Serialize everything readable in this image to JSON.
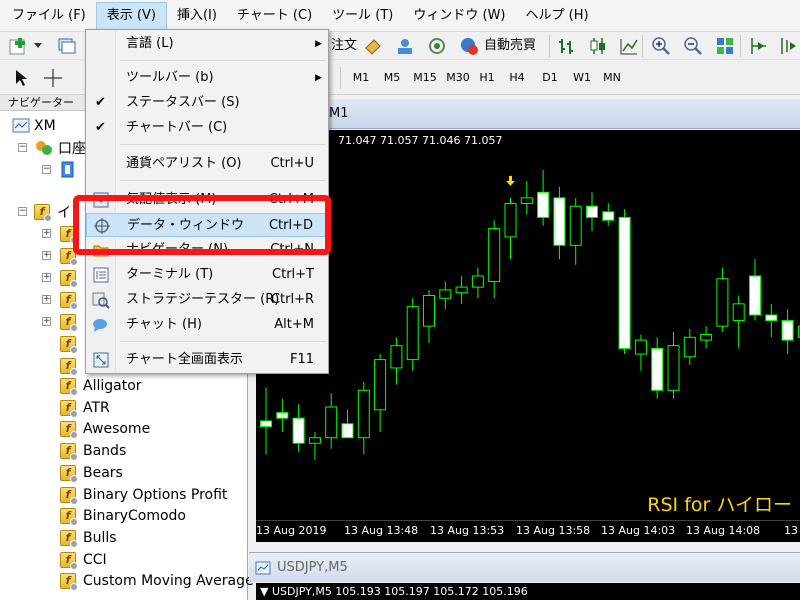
{
  "menubar": [
    "ファイル (F)",
    "表示 (V)",
    "挿入(I)",
    "チャート (C)",
    "ツール (T)",
    "ウィンドウ (W)",
    "ヘルプ (H)"
  ],
  "toolbar": {
    "order_label": "注文",
    "auto_trade_label": "自動売買"
  },
  "timeframes": [
    "M1",
    "M5",
    "M15",
    "M30",
    "H1",
    "H4",
    "D1",
    "W1",
    "MN"
  ],
  "navigator": {
    "title": "ナビゲーター",
    "root": "XM",
    "accounts_label": "口座",
    "indicators_label": "イ",
    "indicators": [
      "Alligator",
      "ATR",
      "Awesome",
      "Bands",
      "Bears",
      "Binary Options Profit",
      "BinaryComodo",
      "Bulls",
      "CCI",
      "Custom Moving Average"
    ]
  },
  "view_menu": {
    "items": [
      {
        "label": "言語 (L)",
        "shortcut": "",
        "submenu": true
      },
      {
        "label": "ツールバー (b)",
        "shortcut": "",
        "submenu": true
      },
      {
        "label": "ステータスバー (S)",
        "shortcut": "",
        "checked": true
      },
      {
        "label": "チャートバー (C)",
        "shortcut": "",
        "checked": true
      },
      {
        "label": "通貨ペアリスト (O)",
        "shortcut": "Ctrl+U"
      },
      {
        "label": "気配値表示 (M)",
        "shortcut": "Ctrl+M"
      },
      {
        "label": "データ・ウィンドウ",
        "shortcut": "Ctrl+D",
        "highlighted": true
      },
      {
        "label": "ナビゲーター (N)",
        "shortcut": "Ctrl+N"
      },
      {
        "label": "ターミナル (T)",
        "shortcut": "Ctrl+T"
      },
      {
        "label": "ストラテジーテスター (R)",
        "shortcut": "Ctrl+R"
      },
      {
        "label": "チャット (H)",
        "shortcut": "Alt+M"
      },
      {
        "label": "チャート全画面表示",
        "shortcut": "F11"
      }
    ]
  },
  "chart": {
    "title": "M1",
    "ohlc": "71.047 71.057 71.046 71.057",
    "watermark": "RSI for ハイロー",
    "x_ticks": [
      "13 Aug 2019",
      "13 Aug 13:48",
      "13 Aug 13:53",
      "13 Aug 13:58",
      "13 Aug 14:03",
      "13 Aug 14:08",
      "13"
    ],
    "colors": {
      "background": "#000000",
      "candle_outline": "#00ff00",
      "bull_body": "#000000",
      "bear_body": "#ffffff",
      "arrow": "#ffd700"
    }
  },
  "chart_data": {
    "type": "candlestick",
    "note_values_in_price_units": true,
    "candles": [
      {
        "o": 71.01,
        "h": 71.022,
        "l": 70.998,
        "c": 71.008
      },
      {
        "o": 71.013,
        "h": 71.018,
        "l": 71.006,
        "c": 71.011
      },
      {
        "o": 71.011,
        "h": 71.016,
        "l": 70.999,
        "c": 71.002
      },
      {
        "o": 71.002,
        "h": 71.006,
        "l": 70.996,
        "c": 71.004
      },
      {
        "o": 71.004,
        "h": 71.02,
        "l": 71.0,
        "c": 71.015
      },
      {
        "o": 71.009,
        "h": 71.014,
        "l": 71.004,
        "c": 71.004
      },
      {
        "o": 71.004,
        "h": 71.024,
        "l": 70.998,
        "c": 71.021
      },
      {
        "o": 71.014,
        "h": 71.034,
        "l": 71.006,
        "c": 71.032
      },
      {
        "o": 71.029,
        "h": 71.04,
        "l": 71.023,
        "c": 71.037
      },
      {
        "o": 71.032,
        "h": 71.054,
        "l": 71.028,
        "c": 71.051
      },
      {
        "o": 71.044,
        "h": 71.057,
        "l": 71.038,
        "c": 71.055
      },
      {
        "o": 71.054,
        "h": 71.06,
        "l": 71.05,
        "c": 71.057
      },
      {
        "o": 71.056,
        "h": 71.062,
        "l": 71.052,
        "c": 71.058
      },
      {
        "o": 71.058,
        "h": 71.065,
        "l": 71.054,
        "c": 71.062
      },
      {
        "o": 71.06,
        "h": 71.082,
        "l": 71.054,
        "c": 71.079
      },
      {
        "o": 71.076,
        "h": 71.09,
        "l": 71.068,
        "c": 71.088
      },
      {
        "o": 71.088,
        "h": 71.096,
        "l": 71.084,
        "c": 71.09
      },
      {
        "o": 71.092,
        "h": 71.1,
        "l": 71.08,
        "c": 71.083
      },
      {
        "o": 71.09,
        "h": 71.094,
        "l": 71.068,
        "c": 71.073
      },
      {
        "o": 71.073,
        "h": 71.09,
        "l": 71.066,
        "c": 71.087
      },
      {
        "o": 71.087,
        "h": 71.092,
        "l": 71.078,
        "c": 71.083
      },
      {
        "o": 71.085,
        "h": 71.088,
        "l": 71.08,
        "c": 71.082
      },
      {
        "o": 71.083,
        "h": 71.086,
        "l": 71.034,
        "c": 71.036
      },
      {
        "o": 71.034,
        "h": 71.041,
        "l": 71.028,
        "c": 71.039
      },
      {
        "o": 71.036,
        "h": 71.04,
        "l": 71.018,
        "c": 71.021
      },
      {
        "o": 71.021,
        "h": 71.042,
        "l": 71.018,
        "c": 71.037
      },
      {
        "o": 71.033,
        "h": 71.043,
        "l": 71.03,
        "c": 71.04
      },
      {
        "o": 71.039,
        "h": 71.044,
        "l": 71.036,
        "c": 71.041
      },
      {
        "o": 71.044,
        "h": 71.065,
        "l": 71.042,
        "c": 71.061
      },
      {
        "o": 71.046,
        "h": 71.055,
        "l": 71.036,
        "c": 71.052
      },
      {
        "o": 71.062,
        "h": 71.068,
        "l": 71.046,
        "c": 71.048
      },
      {
        "o": 71.048,
        "h": 71.052,
        "l": 71.04,
        "c": 71.046
      },
      {
        "o": 71.046,
        "h": 71.05,
        "l": 71.034,
        "c": 71.039
      },
      {
        "o": 71.04,
        "h": 71.048,
        "l": 71.03,
        "c": 71.044
      }
    ],
    "arrow_at_index": 15
  },
  "chart2": {
    "tab": "USDJPY,M5",
    "info": "USDJPY,M5  105.193 105.197 105.172 105.196"
  }
}
